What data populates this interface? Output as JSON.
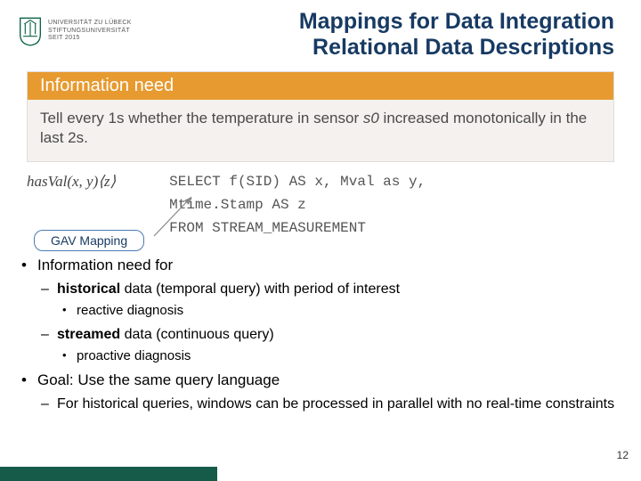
{
  "logo": {
    "line1": "UNIVERSITÄT ZU LÜBECK",
    "line2": "STIFTUNGSUNIVERSITÄT",
    "line3": "SEIT 2015"
  },
  "title": {
    "line1": "Mappings for Data Integration",
    "line2": "Relational Data Descriptions"
  },
  "infobox": {
    "header": "Information need",
    "body_pre": "Tell every 1s whether the temperature in sensor ",
    "body_var": "s0",
    "body_post": " increased monotonically in the last 2s."
  },
  "mapping": {
    "formula": "hasVal(x, y)⟨z⟩",
    "sql1": "SELECT f(SID) AS x, Mval as y,",
    "sql2": "Mtime.Stamp AS z",
    "sql3": "FROM STREAM_MEASUREMENT",
    "label": "GAV Mapping"
  },
  "bullets": {
    "b1": "Information need for",
    "b1a_pre": "historical",
    "b1a_post": " data (temporal query) with period of interest",
    "b1a_i": "reactive diagnosis",
    "b1b_pre": "streamed",
    "b1b_post": " data (continuous query)",
    "b1b_i": "proactive diagnosis",
    "b2": "Goal: Use the same query language",
    "b2a": "For historical queries, windows can be processed in parallel with no real-time constraints"
  },
  "page": "12"
}
